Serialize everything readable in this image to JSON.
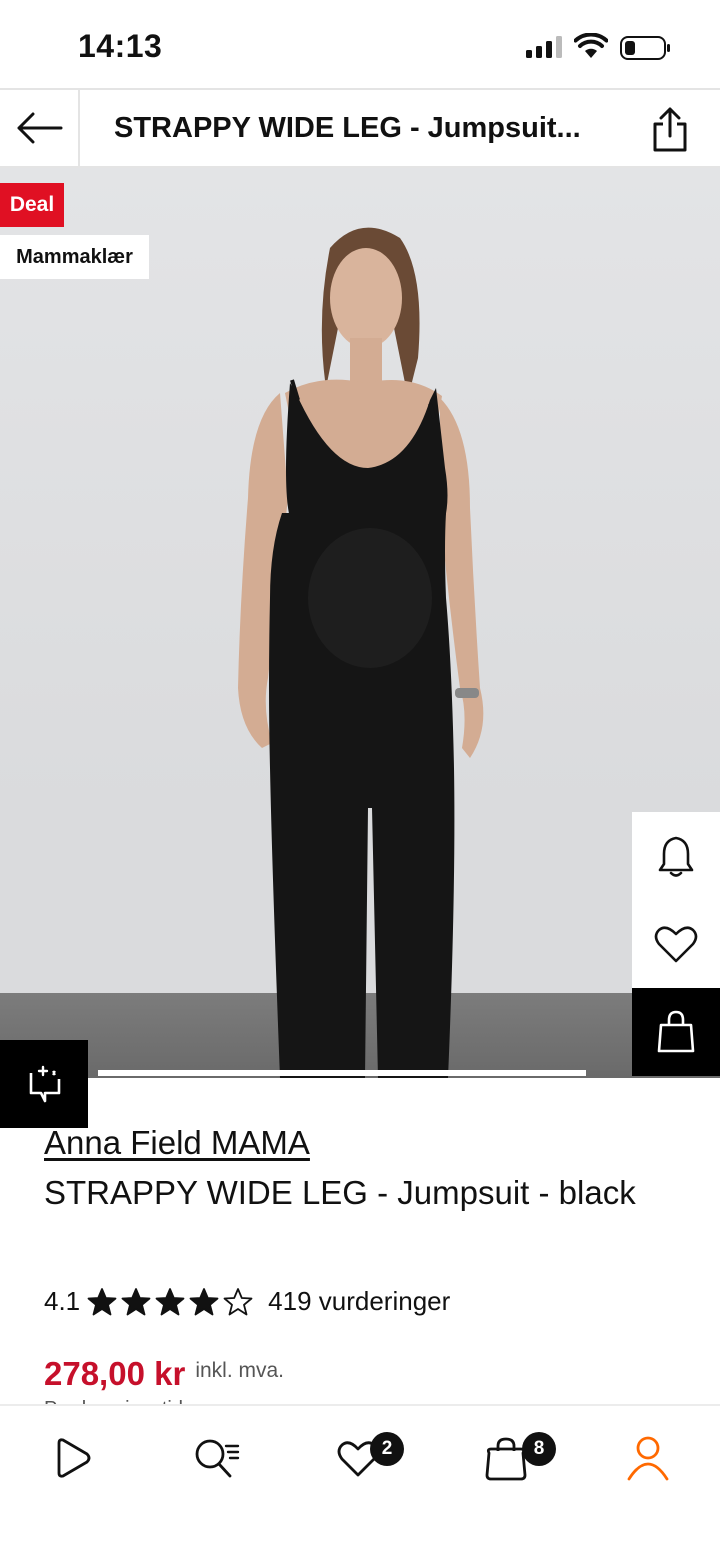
{
  "status_bar": {
    "time": "14:13"
  },
  "header": {
    "title": "STRAPPY WIDE LEG - Jumpsuit..."
  },
  "badges": {
    "deal": "Deal",
    "category": "Mammaklær"
  },
  "product": {
    "brand": "Anna Field MAMA",
    "name": "STRAPPY WIDE LEG - Jumpsuit - black",
    "rating": {
      "score": "4.1",
      "stars_filled": 4,
      "stars_total": 5,
      "count_label": "419 vurderinger"
    },
    "price": {
      "amount": "278,00 kr",
      "vat_label": "inkl. mva."
    },
    "delivery_peek": "Pre-leveringstid: ..."
  },
  "gallery": {
    "progress_fraction": 1.0
  },
  "bottom_nav": {
    "items": [
      {
        "name": "home",
        "icon": "play-icon"
      },
      {
        "name": "search",
        "icon": "search-icon"
      },
      {
        "name": "wishlist",
        "icon": "heart-icon",
        "count": "2"
      },
      {
        "name": "bag",
        "icon": "bag-icon",
        "count": "8"
      },
      {
        "name": "profile",
        "icon": "person-icon",
        "active": true
      }
    ]
  },
  "colors": {
    "accent_red": "#c6102b",
    "deal_red": "#e01023",
    "active_orange": "#ff6900"
  }
}
